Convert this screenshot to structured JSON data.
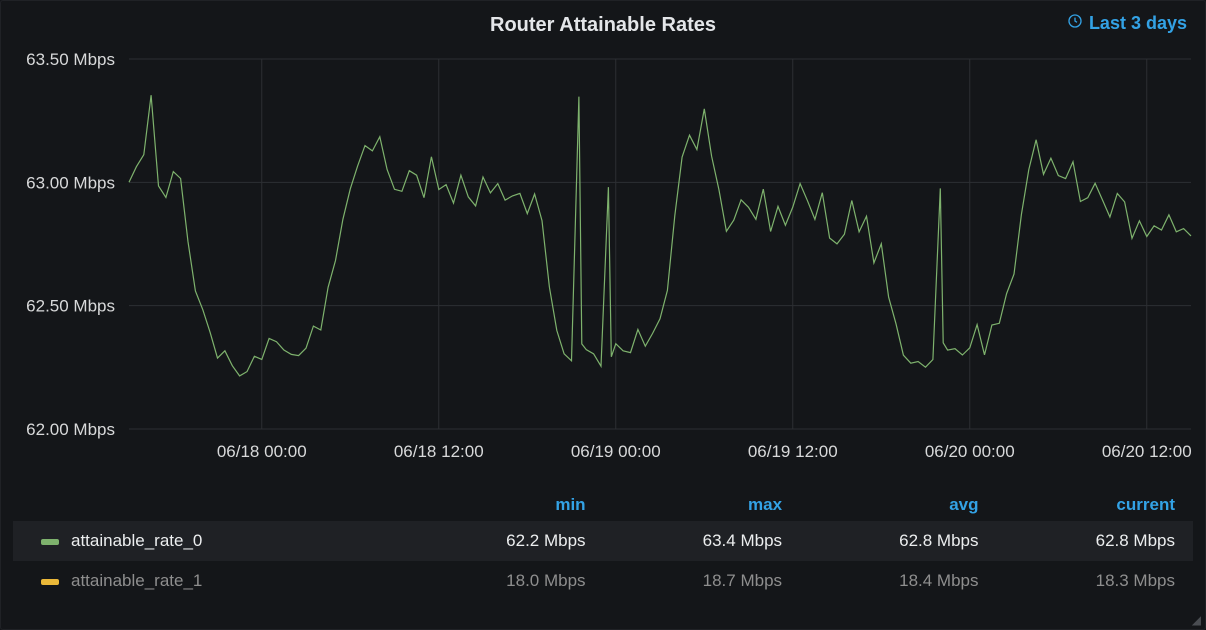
{
  "title": "Router Attainable Rates",
  "timerange_label": "Last 3 days",
  "legend_headers": {
    "min": "min",
    "max": "max",
    "avg": "avg",
    "current": "current"
  },
  "series": [
    {
      "name": "attainable_rate_0",
      "color": "sw-green",
      "min": "62.2 Mbps",
      "max": "63.4 Mbps",
      "avg": "62.8 Mbps",
      "current": "62.8 Mbps"
    },
    {
      "name": "attainable_rate_1",
      "color": "sw-orange",
      "min": "18.0 Mbps",
      "max": "18.7 Mbps",
      "avg": "18.4 Mbps",
      "current": "18.3 Mbps"
    }
  ],
  "chart_data": {
    "type": "line",
    "title": "Router Attainable Rates",
    "xlabel": "",
    "ylabel": "",
    "ylim": [
      62.0,
      63.5
    ],
    "y_ticks": [
      "62.00 Mbps",
      "62.50 Mbps",
      "63.00 Mbps",
      "63.50 Mbps"
    ],
    "x_ticks": [
      "06/18 00:00",
      "06/18 12:00",
      "06/19 00:00",
      "06/19 12:00",
      "06/20 00:00",
      "06/20 12:00"
    ],
    "x_tick_hours": [
      72,
      84,
      96,
      108,
      120,
      132
    ],
    "x_range_hours": [
      63,
      135
    ],
    "series": [
      {
        "name": "attainable_rate_0",
        "color": "#7eb26d",
        "values": [
          [
            63,
            63.0
          ],
          [
            63.5,
            63.05
          ],
          [
            64,
            63.1
          ],
          [
            64.5,
            63.35
          ],
          [
            65,
            63.0
          ],
          [
            65.5,
            62.95
          ],
          [
            66,
            63.05
          ],
          [
            66.5,
            63.0
          ],
          [
            67,
            62.75
          ],
          [
            67.5,
            62.55
          ],
          [
            68,
            62.5
          ],
          [
            68.5,
            62.4
          ],
          [
            69,
            62.3
          ],
          [
            69.5,
            62.3
          ],
          [
            70,
            62.25
          ],
          [
            70.5,
            62.2
          ],
          [
            71,
            62.25
          ],
          [
            71.5,
            62.3
          ],
          [
            72,
            62.3
          ],
          [
            72.5,
            62.35
          ],
          [
            73,
            62.35
          ],
          [
            73.5,
            62.3
          ],
          [
            74,
            62.32
          ],
          [
            74.5,
            62.3
          ],
          [
            75,
            62.35
          ],
          [
            75.5,
            62.4
          ],
          [
            76,
            62.4
          ],
          [
            76.5,
            62.55
          ],
          [
            77,
            62.7
          ],
          [
            77.5,
            62.85
          ],
          [
            78,
            63.0
          ],
          [
            78.5,
            63.05
          ],
          [
            79,
            63.15
          ],
          [
            79.5,
            63.1
          ],
          [
            80,
            63.2
          ],
          [
            80.5,
            63.05
          ],
          [
            81,
            63.0
          ],
          [
            81.5,
            62.95
          ],
          [
            82,
            63.05
          ],
          [
            82.5,
            63.0
          ],
          [
            83,
            62.95
          ],
          [
            83.5,
            63.1
          ],
          [
            84,
            63.0
          ],
          [
            84.5,
            62.98
          ],
          [
            85,
            62.92
          ],
          [
            85.5,
            63.0
          ],
          [
            86,
            62.95
          ],
          [
            86.5,
            62.9
          ],
          [
            87,
            63.05
          ],
          [
            87.5,
            62.95
          ],
          [
            88,
            63.0
          ],
          [
            88.5,
            62.9
          ],
          [
            89,
            62.95
          ],
          [
            89.5,
            62.95
          ],
          [
            90,
            62.9
          ],
          [
            90.5,
            62.95
          ],
          [
            91,
            62.85
          ],
          [
            91.5,
            62.55
          ],
          [
            92,
            62.4
          ],
          [
            92.5,
            62.3
          ],
          [
            93,
            62.3
          ],
          [
            93.5,
            63.35
          ],
          [
            93.7,
            62.35
          ],
          [
            94,
            62.3
          ],
          [
            94.5,
            62.3
          ],
          [
            95,
            62.25
          ],
          [
            95.5,
            63.0
          ],
          [
            95.7,
            62.3
          ],
          [
            96,
            62.35
          ],
          [
            96.5,
            62.3
          ],
          [
            97,
            62.3
          ],
          [
            97.5,
            62.4
          ],
          [
            98,
            62.35
          ],
          [
            98.5,
            62.4
          ],
          [
            99,
            62.45
          ],
          [
            99.5,
            62.55
          ],
          [
            100,
            62.85
          ],
          [
            100.5,
            63.1
          ],
          [
            101,
            63.2
          ],
          [
            101.5,
            63.15
          ],
          [
            102,
            63.3
          ],
          [
            102.5,
            63.1
          ],
          [
            103,
            62.95
          ],
          [
            103.5,
            62.8
          ],
          [
            104,
            62.85
          ],
          [
            104.5,
            62.95
          ],
          [
            105,
            62.9
          ],
          [
            105.5,
            62.85
          ],
          [
            106,
            62.95
          ],
          [
            106.5,
            62.8
          ],
          [
            107,
            62.9
          ],
          [
            107.5,
            62.85
          ],
          [
            108,
            62.9
          ],
          [
            108.5,
            63.0
          ],
          [
            109,
            62.9
          ],
          [
            109.5,
            62.85
          ],
          [
            110,
            62.95
          ],
          [
            110.5,
            62.8
          ],
          [
            111,
            62.75
          ],
          [
            111.5,
            62.8
          ],
          [
            112,
            62.9
          ],
          [
            112.5,
            62.8
          ],
          [
            113,
            62.85
          ],
          [
            113.5,
            62.7
          ],
          [
            114,
            62.75
          ],
          [
            114.5,
            62.55
          ],
          [
            115,
            62.4
          ],
          [
            115.5,
            62.3
          ],
          [
            116,
            62.25
          ],
          [
            116.5,
            62.3
          ],
          [
            117,
            62.25
          ],
          [
            117.5,
            62.3
          ],
          [
            118,
            62.95
          ],
          [
            118.2,
            62.35
          ],
          [
            118.5,
            62.3
          ],
          [
            119,
            62.35
          ],
          [
            119.5,
            62.3
          ],
          [
            120,
            62.35
          ],
          [
            120.5,
            62.4
          ],
          [
            121,
            62.3
          ],
          [
            121.5,
            62.4
          ],
          [
            122,
            62.45
          ],
          [
            122.5,
            62.55
          ],
          [
            123,
            62.65
          ],
          [
            123.5,
            62.85
          ],
          [
            124,
            63.05
          ],
          [
            124.5,
            63.15
          ],
          [
            125,
            63.05
          ],
          [
            125.5,
            63.1
          ],
          [
            126,
            63.05
          ],
          [
            126.5,
            63.0
          ],
          [
            127,
            63.08
          ],
          [
            127.5,
            62.9
          ],
          [
            128,
            62.95
          ],
          [
            128.5,
            63.0
          ],
          [
            129,
            62.95
          ],
          [
            129.5,
            62.85
          ],
          [
            130,
            62.95
          ],
          [
            130.5,
            62.9
          ],
          [
            131,
            62.78
          ],
          [
            131.5,
            62.85
          ],
          [
            132,
            62.8
          ],
          [
            132.5,
            62.82
          ],
          [
            133,
            62.8
          ],
          [
            133.5,
            62.85
          ],
          [
            134,
            62.8
          ],
          [
            134.5,
            62.82
          ],
          [
            135,
            62.8
          ]
        ]
      }
    ]
  }
}
